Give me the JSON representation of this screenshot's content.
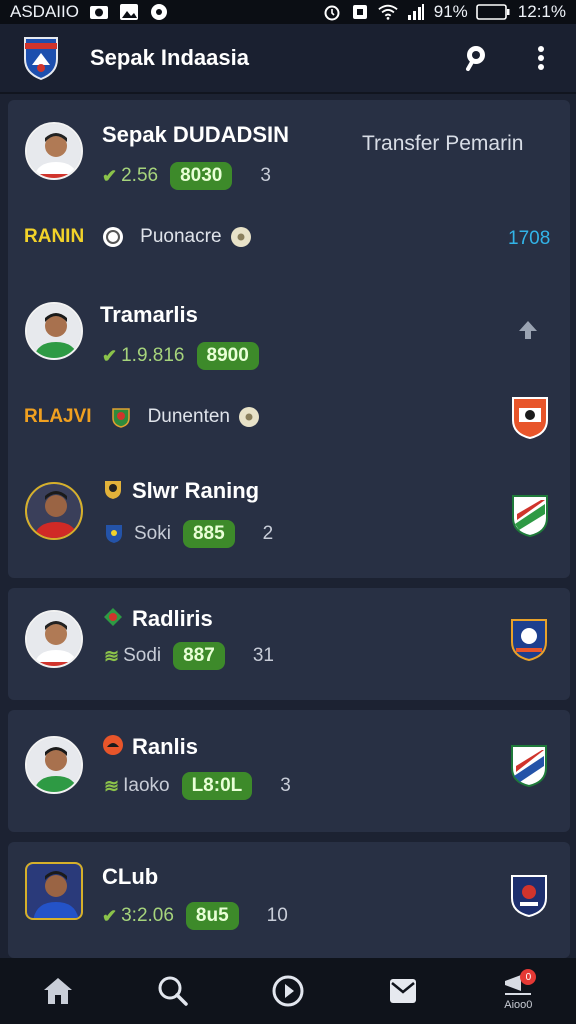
{
  "status_bar": {
    "carrier": "ASDAIIO",
    "battery": "91%",
    "time": "12:1%"
  },
  "app": {
    "title": "Sepak Indaasia"
  },
  "main_card": {
    "transfer_label": "Transfer Pemarin",
    "players": [
      {
        "name": "Sepak DUDADSIN",
        "trend_value": "2.56",
        "pill": "8030",
        "rank": "3"
      },
      {
        "name": "Tramarlis",
        "trend_value": "1.9.816",
        "pill": "8900",
        "rank": ""
      },
      {
        "name": "Slwr Raning",
        "trend_value": "Soki",
        "pill": "885",
        "rank": "2"
      }
    ],
    "leagues": [
      {
        "tag": "RANIN",
        "name": "Puonacre",
        "value": "1708"
      },
      {
        "tag": "RLAJVI",
        "name": "Dunenten",
        "value": ""
      }
    ]
  },
  "cards": [
    {
      "name": "Radliris",
      "trend_value": "Sodi",
      "pill": "887",
      "rank": "31"
    },
    {
      "name": "Ranlis",
      "trend_value": "Iaoko",
      "pill": "L8:0L",
      "rank": "3"
    },
    {
      "name": "CLub",
      "trend_value": "3:2.06",
      "pill": "8u5",
      "rank": "10"
    }
  ],
  "bottom_nav": {
    "items": [
      "home",
      "search",
      "play",
      "inbox",
      "transfers"
    ],
    "last_label": "Aioo0",
    "badge": "0"
  },
  "colors": {
    "pill_green": "#3d8a2a",
    "trend_green": "#8bc34a",
    "tag_yellow": "#f2d22a",
    "tag_orange": "#f0a020",
    "accent_cyan": "#32b4e8"
  }
}
